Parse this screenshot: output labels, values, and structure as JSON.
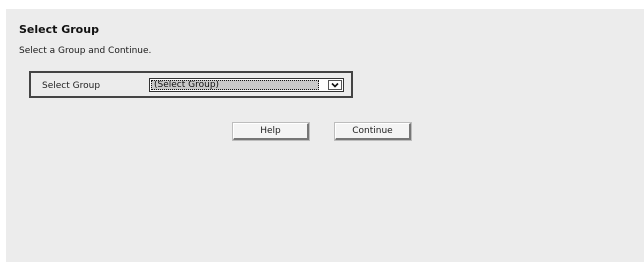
{
  "page": {
    "title": "Select Group",
    "instruction": "Select a Group and Continue."
  },
  "form": {
    "group_label": "Select Group",
    "group_select": {
      "selected": "(Select Group)",
      "arrow_icon": "chevron-down-icon"
    }
  },
  "actions": {
    "help_label": "Help",
    "continue_label": "Continue"
  },
  "colors": {
    "panel_background": "#ececec",
    "box_border": "#444444",
    "selected_option_background": "#c9c9c9"
  }
}
